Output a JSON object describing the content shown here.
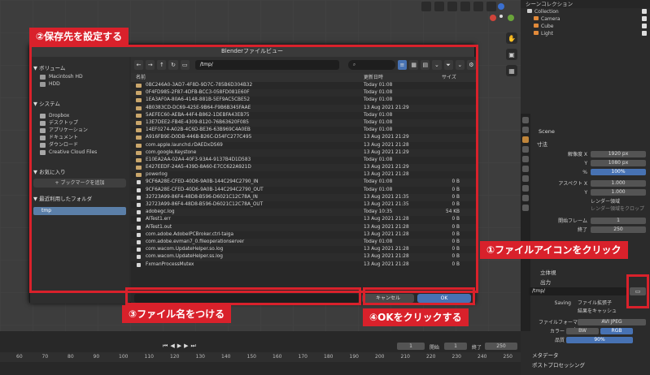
{
  "dialog": {
    "title": "Blenderファイルビュー",
    "path": "/tmp/",
    "search_placeholder": "",
    "volumes_header": "ボリューム",
    "volumes": [
      "Macintosh HD",
      "HDD"
    ],
    "system_header": "システム",
    "system_items": [
      "Dropbox",
      "デスクトップ",
      "アプリケーション",
      "ドキュメント",
      "ダウンロード",
      "Creative Cloud Files"
    ],
    "favorites_header": "お気に入り",
    "add_bookmark": "ブックマークを追加",
    "recent_header": "最近利用したフォルダ",
    "recent_items": [
      "tmp"
    ],
    "col_name": "名前",
    "col_date": "更新日時",
    "col_size": "サイズ",
    "rows": [
      {
        "name": "0BC246A0-3AD7-4F8D-9D7C-785B6D304B32",
        "date": "Today 01:08",
        "size": "",
        "folder": true
      },
      {
        "name": "0F4FD985-2F87-4DFB-BCC3-058FD081E60F",
        "date": "Today 01:08",
        "size": "",
        "folder": true
      },
      {
        "name": "1EA3AF0A-80A6-4148-881B-5EF9AC5CBE52",
        "date": "Today 01:08",
        "size": "",
        "folder": true
      },
      {
        "name": "4B0383CD-DC69-425E-9B64-F9B6B345FAAE",
        "date": "13 Aug 2021 21:29",
        "size": "",
        "folder": true
      },
      {
        "name": "5AEFEC60-AEBA-44F4-B862-1DEBFA43EB75",
        "date": "Today 01:08",
        "size": "",
        "folder": true
      },
      {
        "name": "13E7DEE2-FB4E-4309-8120-76B63620F085",
        "date": "Today 01:08",
        "size": "",
        "folder": true
      },
      {
        "name": "14EF0274-A02B-4C6D-BE36-63B969C4A0EB",
        "date": "Today 01:08",
        "size": "",
        "folder": true
      },
      {
        "name": "A916FB9E-D0DB-446B-B26C-D54FC277C495",
        "date": "13 Aug 2021 21:29",
        "size": "",
        "folder": true
      },
      {
        "name": "com.apple.launchd.rDAEDxDS69",
        "date": "13 Aug 2021 21:28",
        "size": "",
        "folder": true
      },
      {
        "name": "com.google.Keystone",
        "date": "13 Aug 2021 21:29",
        "size": "",
        "folder": true
      },
      {
        "name": "E10EA2AA-02A4-40F3-93A4-9137B4D1D583",
        "date": "Today 01:08",
        "size": "",
        "folder": true
      },
      {
        "name": "E427EEDF-24A5-439D-8A60-E7CC622A921D",
        "date": "13 Aug 2021 21:29",
        "size": "",
        "folder": true
      },
      {
        "name": "powerlog",
        "date": "13 Aug 2021 21:28",
        "size": "",
        "folder": true
      },
      {
        "name": "9CF6A28E-CFED-40D6-9A0B-144C294C2790_IN",
        "date": "Today 01:08",
        "size": "0 B",
        "folder": false
      },
      {
        "name": "9CF6A28E-CFED-40D6-9A0B-144C294C2790_OUT",
        "date": "Today 01:08",
        "size": "0 B",
        "folder": false
      },
      {
        "name": "32723A99-86F4-48D8-B596-D6021C12C78A_IN",
        "date": "13 Aug 2021 21:35",
        "size": "0 B",
        "folder": false
      },
      {
        "name": "32723A99-86F4-48D8-B596-D6021C12C78A_OUT",
        "date": "13 Aug 2021 21:35",
        "size": "0 B",
        "folder": false
      },
      {
        "name": "adobegc.log",
        "date": "Today 10:35",
        "size": "54 KB",
        "folder": false
      },
      {
        "name": "AITest1.err",
        "date": "13 Aug 2021 21:28",
        "size": "0 B",
        "folder": false
      },
      {
        "name": "AITest1.out",
        "date": "13 Aug 2021 21:28",
        "size": "0 B",
        "folder": false
      },
      {
        "name": "com.adobe.AdobeIPCBroker.ctrl-taiga",
        "date": "13 Aug 2021 21:28",
        "size": "0 B",
        "folder": false
      },
      {
        "name": "com.adobe.evman7_0.fileoperationserver",
        "date": "Today 01:08",
        "size": "0 B",
        "folder": false
      },
      {
        "name": "com.wacom.UpdateHelper.so.log",
        "date": "13 Aug 2021 21:28",
        "size": "0 B",
        "folder": false
      },
      {
        "name": "com.wacom.UpdateHelper.ss.log",
        "date": "13 Aug 2021 21:28",
        "size": "0 B",
        "folder": false
      },
      {
        "name": "FxmanProcessMutex",
        "date": "13 Aug 2021 21:28",
        "size": "0 B",
        "folder": false
      }
    ],
    "cancel_label": "キャンセル",
    "ok_label": "OK"
  },
  "annotations": {
    "step2": "②保存先を設定する",
    "step1": "①ファイルアイコンをクリック",
    "step3": "③ファイル名をつける",
    "step4": "④OKをクリックする"
  },
  "outliner": {
    "title": "シーンコレクション",
    "items": [
      "Collection",
      "Camera",
      "Cube",
      "Light"
    ]
  },
  "props": {
    "scene_label": "Scene",
    "dimensions_header": "寸法",
    "res_x_label": "解像度 X",
    "res_x": "1920 px",
    "res_y_label": "Y",
    "res_y": "1080 px",
    "percent_label": "%",
    "percent": "100%",
    "aspect_x_label": "アスペクト X",
    "aspect_x": "1.000",
    "aspect_y_label": "Y",
    "aspect_y": "1.000",
    "border_label": "レンダー領域",
    "crop_label": "レンダー領域をクロップ",
    "frame_start_label": "開始フレーム",
    "frame_start": "1",
    "frame_end_label": "終了",
    "frame_end": "250",
    "stereo_label": "立体視",
    "output_header": "出力",
    "output_path": "/tmp/",
    "saving_label": "Saving",
    "file_ext_label": "ファイル拡張子",
    "cache_label": "結果をキャッシュ",
    "format_label": "ファイルフォーマット",
    "format_value": "AVI JPEG",
    "color_label": "カラー",
    "bw": "BW",
    "rgb": "RGB",
    "quality_label": "品質",
    "quality": "90%",
    "metadata_header": "メタデータ",
    "post_header": "ポストプロセッシング"
  },
  "timeline": {
    "current_frame": "1",
    "start_label": "開始",
    "start": "1",
    "end_label": "終了",
    "end": "250",
    "ticks": [
      "60",
      "70",
      "80",
      "90",
      "100",
      "110",
      "120",
      "130",
      "140",
      "150",
      "160",
      "170",
      "180",
      "190",
      "200",
      "210",
      "220",
      "230",
      "240",
      "250"
    ]
  }
}
